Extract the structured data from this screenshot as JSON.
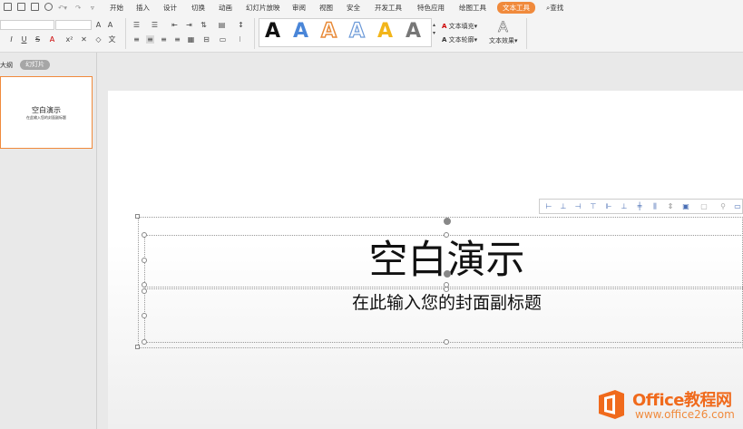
{
  "menu": {
    "tabs": [
      "开始",
      "插入",
      "设计",
      "切换",
      "动画",
      "幻灯片放映",
      "审阅",
      "视图",
      "安全",
      "开发工具",
      "特色应用",
      "绘图工具",
      "文本工具"
    ],
    "active_tab": "文本工具",
    "search_label": "查找",
    "accent_color": "#f08a3c"
  },
  "ribbon": {
    "text_fill_label": "文本填充",
    "text_outline_label": "文本轮廓",
    "text_effect_label": "文本效果",
    "art_styles": [
      {
        "name": "black-fill",
        "color": "#111111"
      },
      {
        "name": "blue-fill",
        "color": "#4a86d8"
      },
      {
        "name": "orange-outline",
        "color": "#e88a38"
      },
      {
        "name": "blue-outline",
        "color": "#6d9ad8"
      },
      {
        "name": "gold-fill",
        "color": "#f2b51a"
      },
      {
        "name": "gray-fill",
        "color": "#777777"
      }
    ],
    "font_name_value": "",
    "font_size_value": ""
  },
  "panel": {
    "outline_label": "大纲",
    "slides_label": "幻灯片"
  },
  "thumbnail": {
    "title": "空白演示",
    "subtitle": "在此输入您的封面副标题"
  },
  "slide": {
    "title": "空白演示",
    "subtitle": "在此输入您的封面副标题"
  },
  "watermark": {
    "brand": "Office教程网",
    "url": "www.office26.com"
  }
}
